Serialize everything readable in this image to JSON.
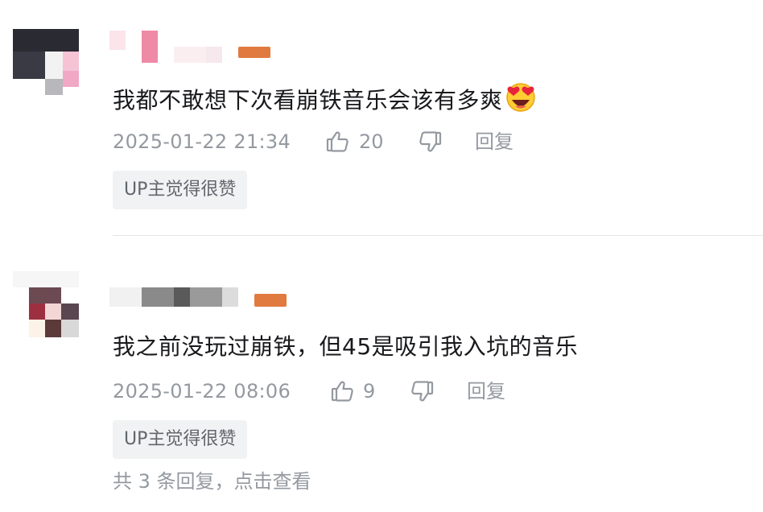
{
  "comments": [
    {
      "text": "我都不敢想下次看崩铁音乐会该有多爽",
      "emoji": "heart-eyes-emoji",
      "time": "2025-01-22 21:34",
      "likes": "20",
      "reply_label": "回复",
      "tag": "UP主觉得很赞"
    },
    {
      "text": "我之前没玩过崩铁，但45是吸引我入坑的音乐",
      "time": "2025-01-22 08:06",
      "likes": "9",
      "reply_label": "回复",
      "tag": "UP主觉得很赞"
    }
  ],
  "replies_link": "共 3 条回复，点击查看",
  "colors": {
    "level_badge": "#e07a3f",
    "meta_text": "#9499a0",
    "tag_bg": "#f1f2f3"
  }
}
